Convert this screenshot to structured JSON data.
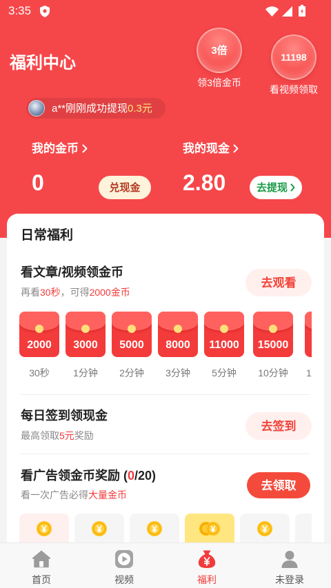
{
  "status_bar": {
    "time": "3:35",
    "icons": [
      "shield-icon",
      "wifi-icon",
      "signal-icon",
      "battery-icon"
    ]
  },
  "header": {
    "title": "福利中心"
  },
  "bubbles": [
    {
      "value": "3倍",
      "label": "领3倍金币"
    },
    {
      "value": "11198",
      "label": "看视频领取"
    }
  ],
  "ticker": {
    "text": "a**刚刚成功提现",
    "amount": "0.3元"
  },
  "wallet": {
    "coins": {
      "label": "我的金币",
      "value": "0",
      "button": "兑现金"
    },
    "cash": {
      "label": "我的现金",
      "value": "2.80",
      "button": "去提现"
    }
  },
  "daily": {
    "title": "日常福利",
    "watch": {
      "title": "看文章/视频领金币",
      "subtitle_prefix": "再看",
      "subtitle_time": "30秒",
      "subtitle_mid": "，可得",
      "subtitle_reward": "2000金币",
      "button": "去观看",
      "envelopes": [
        {
          "amount": "2000",
          "label": "30秒"
        },
        {
          "amount": "3000",
          "label": "1分钟"
        },
        {
          "amount": "5000",
          "label": "2分钟"
        },
        {
          "amount": "8000",
          "label": "3分钟"
        },
        {
          "amount": "11000",
          "label": "5分钟"
        },
        {
          "amount": "15000",
          "label": "10分钟"
        },
        {
          "label": "1"
        }
      ]
    },
    "signin": {
      "title": "每日签到领现金",
      "subtitle_prefix": "最高领取",
      "subtitle_amount": "5元",
      "subtitle_suffix": "奖励",
      "button": "去签到"
    },
    "ads": {
      "title_prefix": "看广告领金币奖励 (",
      "title_count": "0",
      "title_suffix": "/20)",
      "subtitle_prefix": "看一次广告必得",
      "subtitle_highlight": "大量金币",
      "button": "去领取",
      "reward_cards": [
        {
          "coins": 1,
          "bg": "#fff0f0"
        },
        {
          "coins": 1,
          "bg": "#f5f5f5"
        },
        {
          "coins": 1,
          "bg": "#f5f5f5"
        },
        {
          "coins": 2,
          "bg": "#ffe680"
        },
        {
          "coins": 1,
          "bg": "#f5f5f5"
        },
        {
          "bg": "#f5f5f5"
        }
      ]
    }
  },
  "nav": {
    "items": [
      {
        "label": "首页",
        "icon": "home-icon",
        "active": false
      },
      {
        "label": "视频",
        "icon": "video-icon",
        "active": false
      },
      {
        "label": "福利",
        "icon": "money-bag-icon",
        "active": true
      },
      {
        "label": "未登录",
        "icon": "user-icon",
        "active": false
      }
    ]
  },
  "colors": {
    "header_bg": "#f5474a",
    "accent_red": "#f23b3b",
    "withdraw_green": "#179a45",
    "ticker_amount": "#ffe680",
    "coin_gold": "#ffc21a"
  }
}
